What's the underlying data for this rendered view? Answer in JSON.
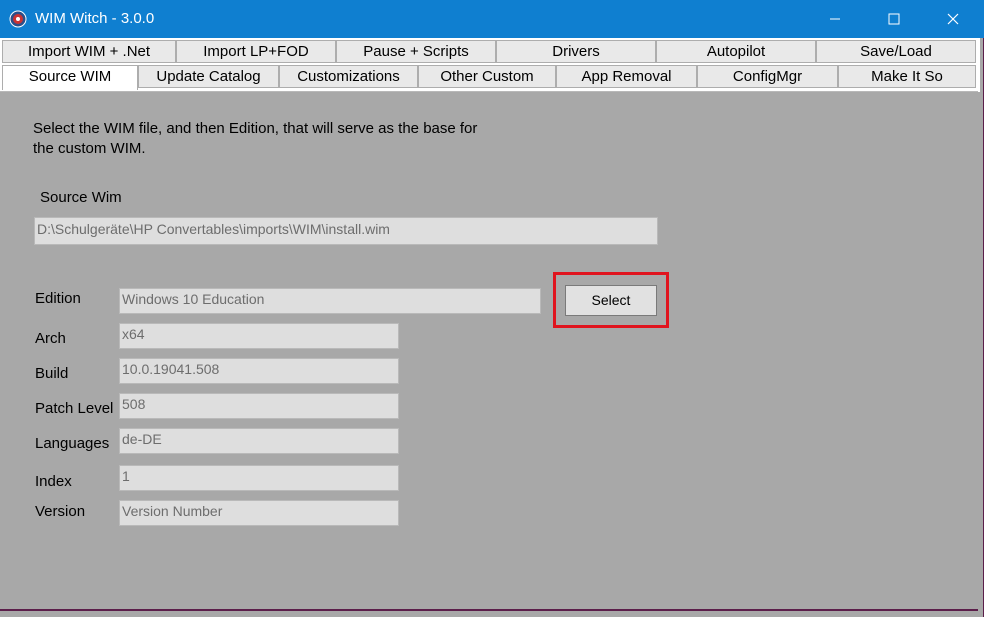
{
  "window": {
    "title": "WIM Witch - 3.0.0"
  },
  "tabs_row1": [
    "Import WIM + .Net",
    "Import LP+FOD",
    "Pause + Scripts",
    "Drivers",
    "Autopilot",
    "Save/Load"
  ],
  "tabs_row2": [
    "Source WIM",
    "Update Catalog",
    "Customizations",
    "Other Custom",
    "App Removal",
    "ConfigMgr",
    "Make It So"
  ],
  "main": {
    "instructions": "Select the WIM file, and then Edition, that will serve as the base for",
    "instructions_line2": "the custom WIM.",
    "source_label": "Source Wim",
    "source_path": "D:\\Schulgeräte\\HP Convertables\\imports\\WIM\\install.wim",
    "edition_label": "Edition",
    "edition_value": "Windows 10 Education",
    "select_label": "Select",
    "arch_label": "Arch",
    "arch_value": "x64",
    "build_label": "Build",
    "build_value": "10.0.19041.508",
    "patch_label": "Patch Level",
    "patch_value": "508",
    "languages_label": "Languages",
    "languages_value": "de-DE",
    "index_label": "Index",
    "index_value": "1",
    "version_label": "Version",
    "version_value": "Version Number"
  },
  "colors": {
    "titlebar": "#0f7fd0",
    "background": "#a8a8a8",
    "highlight": "#e0141e"
  }
}
